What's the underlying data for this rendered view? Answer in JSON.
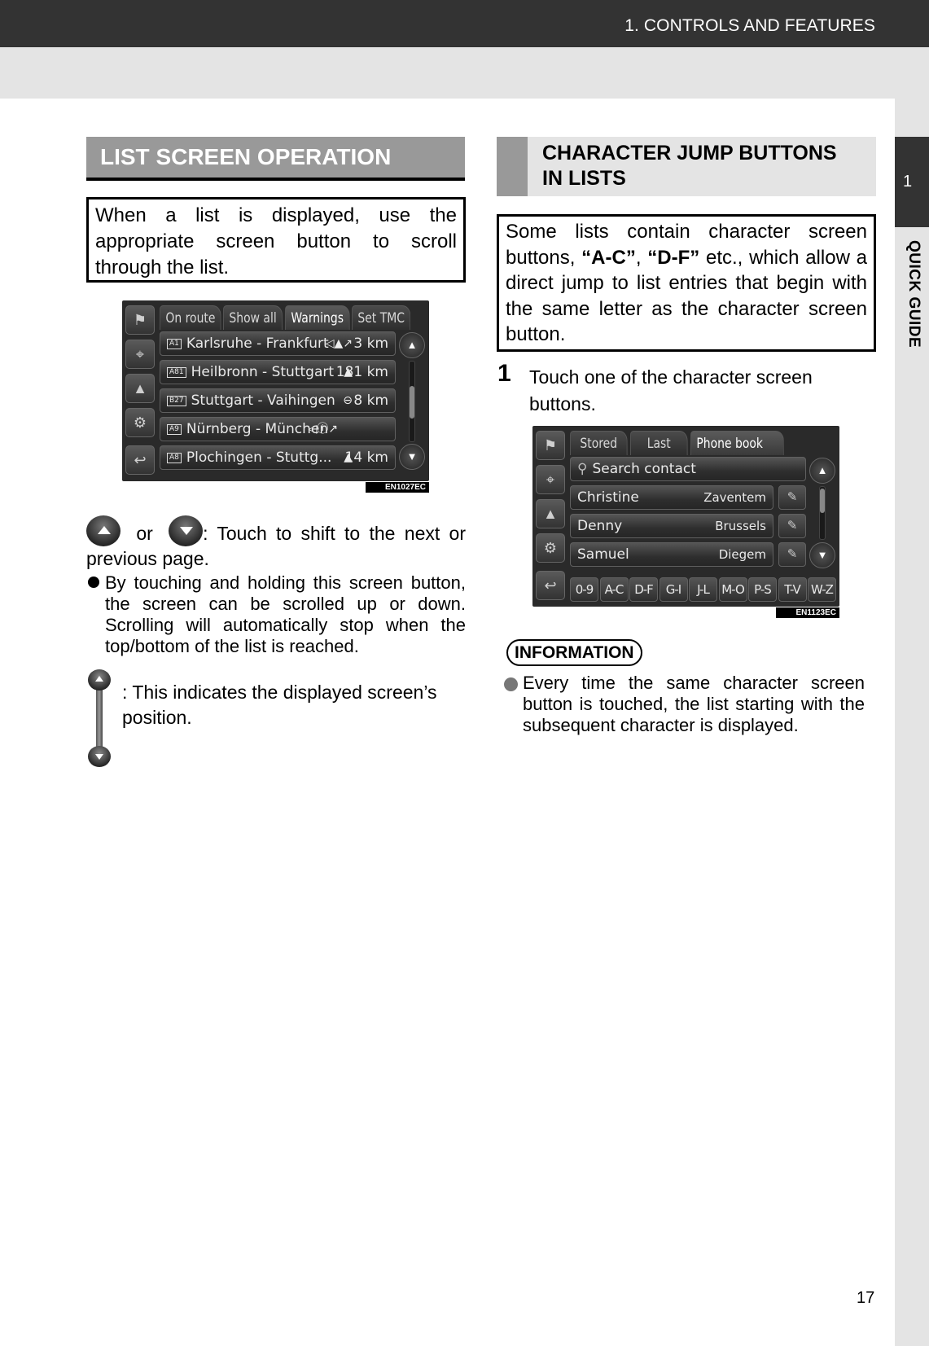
{
  "header": {
    "section_title": "1. CONTROLS AND FEATURES"
  },
  "side_tab": {
    "chapter_number": "1",
    "chapter_label": "QUICK GUIDE"
  },
  "left": {
    "heading": "LIST SCREEN OPERATION",
    "intro": "When a list is displayed, use the appropriate screen button to scroll through the list.",
    "screenshot1": {
      "tabs": [
        "On route",
        "Show all",
        "Warnings",
        "Set TMC"
      ],
      "active_tab": "Warnings",
      "side_buttons": [
        "destination-flag-icon",
        "map-settings-icon",
        "traffic-icon",
        "settings-gear-icon",
        "back-icon"
      ],
      "rows": [
        {
          "road": "A1",
          "route": "Karlsruhe - Frankfurt",
          "icon": "traffic-warning-icon",
          "distance": "3 km"
        },
        {
          "road": "A81",
          "route": "Heilbronn - Stuttgart",
          "icon": "roadwork-icon",
          "distance": "181 km"
        },
        {
          "road": "B27",
          "route": "Stuttgart - Vaihingen",
          "icon": "no-entry-icon",
          "distance": "8 km"
        },
        {
          "road": "A9",
          "route": "Nürnberg - München",
          "icon": "info-icon",
          "distance": ""
        },
        {
          "road": "A8",
          "route": "Plochingen - Stuttg...",
          "icon": "warning-icon",
          "distance": "14 km"
        }
      ],
      "code": "EN1027EC"
    },
    "scroll_desc_or": "or",
    "scroll_desc": ": Touch to shift to the next or previous page.",
    "scroll_bullet": "By touching and holding this screen button, the screen can be scrolled up or down. Scrolling will automatically stop when the top/bottom of the list is reached.",
    "position_desc": ": This indicates the displayed screen’s position."
  },
  "right": {
    "heading_line1": "CHARACTER JUMP BUTTONS",
    "heading_line2": "IN LISTS",
    "intro_part1": "Some lists contain character screen buttons, ",
    "intro_bold1": "“A-C”",
    "intro_part2": ", ",
    "intro_bold2": "“D-F”",
    "intro_part3": " etc., which allow a direct jump to list entries that begin with the same letter as the character screen button.",
    "step_number": "1",
    "step_text": "Touch one of the character screen buttons.",
    "screenshot2": {
      "tabs": [
        "Stored",
        "Last",
        "Phone book"
      ],
      "active_tab": "Phone book",
      "search_label": "Search contact",
      "contacts": [
        {
          "name": "Christine",
          "city": "Zaventem"
        },
        {
          "name": "Denny",
          "city": "Brussels"
        },
        {
          "name": "Samuel",
          "city": "Diegem"
        }
      ],
      "jump_buttons": [
        "0-9",
        "A-C",
        "D-F",
        "G-I",
        "J-L",
        "M-O",
        "P-S",
        "T-V",
        "W-Z"
      ],
      "code": "EN1123EC"
    },
    "info_badge": "INFORMATION",
    "info_text": "Every time the same character screen button is touched, the list starting with the subsequent character is displayed."
  },
  "footer": {
    "page_number": "17"
  }
}
